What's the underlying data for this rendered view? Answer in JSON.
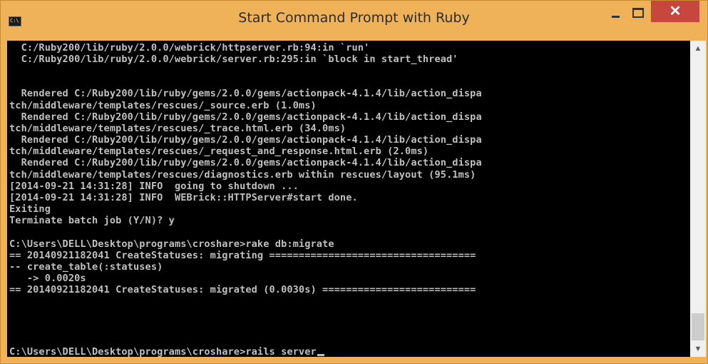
{
  "window": {
    "title": "Start Command Prompt with Ruby",
    "icon_label": "C:\\",
    "close_glyph": "✕"
  },
  "console": {
    "lines": [
      "  C:/Ruby200/lib/ruby/2.0.0/webrick/httpserver.rb:94:in `run'",
      "  C:/Ruby200/lib/ruby/2.0.0/webrick/server.rb:295:in `block in start_thread'",
      "",
      "",
      "  Rendered C:/Ruby200/lib/ruby/gems/2.0.0/gems/actionpack-4.1.4/lib/action_dispa",
      "tch/middleware/templates/rescues/_source.erb (1.0ms)",
      "  Rendered C:/Ruby200/lib/ruby/gems/2.0.0/gems/actionpack-4.1.4/lib/action_dispa",
      "tch/middleware/templates/rescues/_trace.html.erb (34.0ms)",
      "  Rendered C:/Ruby200/lib/ruby/gems/2.0.0/gems/actionpack-4.1.4/lib/action_dispa",
      "tch/middleware/templates/rescues/_request_and_response.html.erb (2.0ms)",
      "  Rendered C:/Ruby200/lib/ruby/gems/2.0.0/gems/actionpack-4.1.4/lib/action_dispa",
      "tch/middleware/templates/rescues/diagnostics.erb within rescues/layout (95.1ms)",
      "[2014-09-21 14:31:28] INFO  going to shutdown ...",
      "[2014-09-21 14:31:28] INFO  WEBrick::HTTPServer#start done.",
      "Exiting",
      "Terminate batch job (Y/N)? y",
      "",
      "C:\\Users\\DELL\\Desktop\\programs\\croshare>rake db:migrate",
      "== 20140921182041 CreateStatuses: migrating ===================================",
      "-- create_table(:statuses)",
      "   -> 0.0020s",
      "== 20140921182041 CreateStatuses: migrated (0.0030s) ==========================",
      "",
      "",
      "",
      "C:\\Users\\DELL\\Desktop\\programs\\croshare>rails server"
    ]
  },
  "scrollbar": {
    "up_glyph": "▲",
    "down_glyph": "▼",
    "position_fraction": 0.92
  }
}
